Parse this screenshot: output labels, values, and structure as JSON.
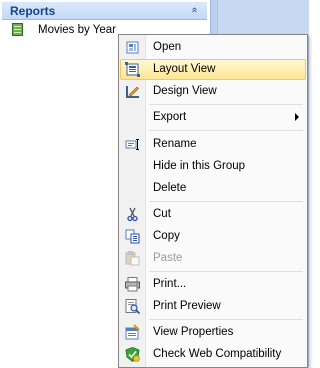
{
  "nav": {
    "group_title": "Reports",
    "collapse_glyph": "«",
    "item_label": "Movies by Year"
  },
  "menu": {
    "items": [
      {
        "label": "Open",
        "icon": "open-icon"
      },
      {
        "label": "Layout View",
        "icon": "layout-view-icon",
        "hover": true
      },
      {
        "label": "Design View",
        "icon": "design-view-icon"
      },
      {
        "label": "Export",
        "icon": "",
        "submenu": true
      },
      {
        "label": "Rename",
        "icon": "rename-icon"
      },
      {
        "label": "Hide in this Group",
        "icon": ""
      },
      {
        "label": "Delete",
        "icon": ""
      },
      {
        "label": "Cut",
        "icon": "cut-icon"
      },
      {
        "label": "Copy",
        "icon": "copy-icon"
      },
      {
        "label": "Paste",
        "icon": "paste-icon",
        "disabled": true
      },
      {
        "label": "Print...",
        "icon": "print-icon"
      },
      {
        "label": "Print Preview",
        "icon": "print-preview-icon"
      },
      {
        "label": "View Properties",
        "icon": "view-properties-icon"
      },
      {
        "label": "Check Web Compatibility",
        "icon": "check-web-compat-icon"
      }
    ]
  },
  "colors": {
    "header_text": "#15428b",
    "hover_bg": "#ffe692",
    "disabled_text": "#9a9a9a"
  }
}
